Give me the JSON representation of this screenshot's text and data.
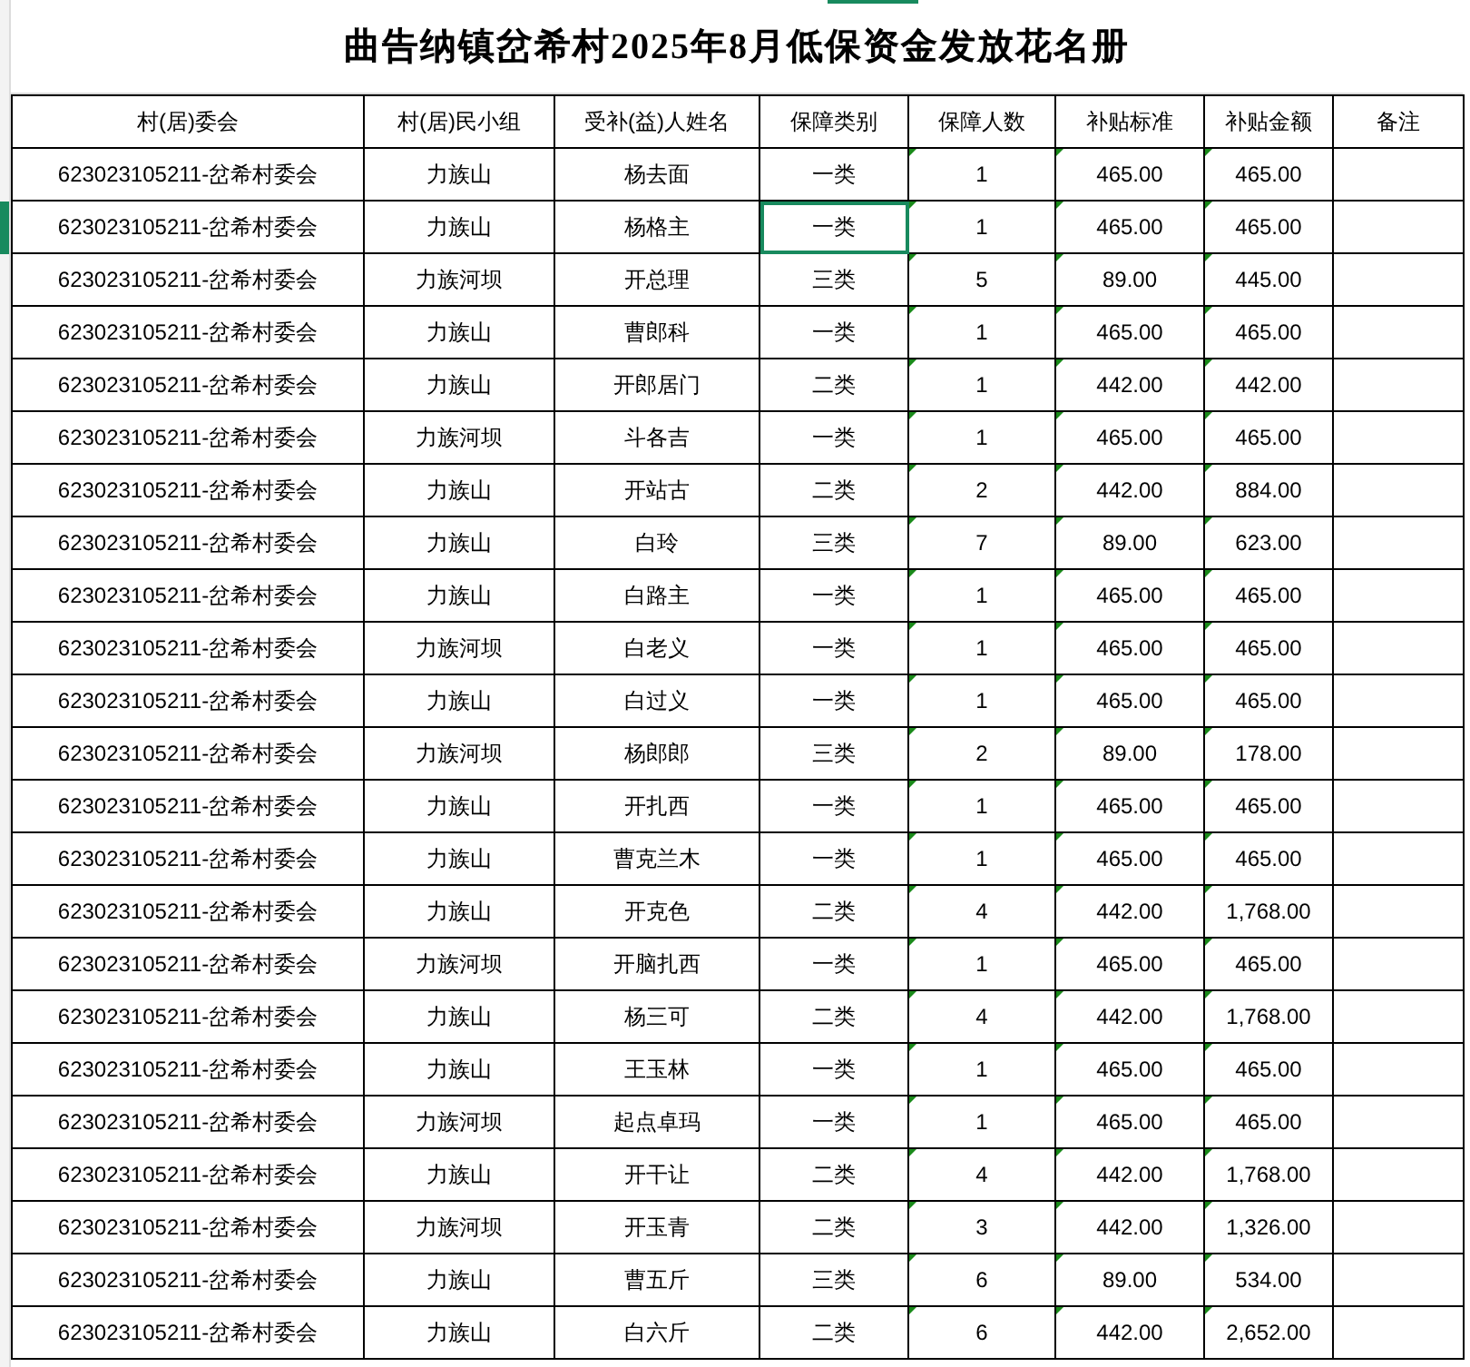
{
  "title": "曲告纳镇岔希村2025年8月低保资金发放花名册",
  "columns": [
    "村(居)委会",
    "村(居)民小组",
    "受补(益)人姓名",
    "保障类别",
    "保障人数",
    "补贴标准",
    "补贴金额",
    "备注"
  ],
  "rows": [
    {
      "cells": [
        "623023105211-岔希村委会",
        "力族山",
        "杨去面",
        "一类",
        "1",
        "465.00",
        "465.00"
      ],
      "selected": false
    },
    {
      "cells": [
        "623023105211-岔希村委会",
        "力族山",
        "杨格主",
        "一类",
        "1",
        "465.00",
        "465.00"
      ],
      "selected": true
    },
    {
      "cells": [
        "623023105211-岔希村委会",
        "力族河坝",
        "开总理",
        "三类",
        "5",
        "89.00",
        "445.00"
      ],
      "selected": false
    },
    {
      "cells": [
        "623023105211-岔希村委会",
        "力族山",
        "曹郎科",
        "一类",
        "1",
        "465.00",
        "465.00"
      ],
      "selected": false
    },
    {
      "cells": [
        "623023105211-岔希村委会",
        "力族山",
        "开郎居门",
        "二类",
        "1",
        "442.00",
        "442.00"
      ],
      "selected": false
    },
    {
      "cells": [
        "623023105211-岔希村委会",
        "力族河坝",
        "斗各吉",
        "一类",
        "1",
        "465.00",
        "465.00"
      ],
      "selected": false
    },
    {
      "cells": [
        "623023105211-岔希村委会",
        "力族山",
        "开站古",
        "二类",
        "2",
        "442.00",
        "884.00"
      ],
      "selected": false
    },
    {
      "cells": [
        "623023105211-岔希村委会",
        "力族山",
        "白玲",
        "三类",
        "7",
        "89.00",
        "623.00"
      ],
      "selected": false
    },
    {
      "cells": [
        "623023105211-岔希村委会",
        "力族山",
        "白路主",
        "一类",
        "1",
        "465.00",
        "465.00"
      ],
      "selected": false
    },
    {
      "cells": [
        "623023105211-岔希村委会",
        "力族河坝",
        "白老义",
        "一类",
        "1",
        "465.00",
        "465.00"
      ],
      "selected": false
    },
    {
      "cells": [
        "623023105211-岔希村委会",
        "力族山",
        "白过义",
        "一类",
        "1",
        "465.00",
        "465.00"
      ],
      "selected": false
    },
    {
      "cells": [
        "623023105211-岔希村委会",
        "力族河坝",
        "杨郎郎",
        "三类",
        "2",
        "89.00",
        "178.00"
      ],
      "selected": false
    },
    {
      "cells": [
        "623023105211-岔希村委会",
        "力族山",
        "开扎西",
        "一类",
        "1",
        "465.00",
        "465.00"
      ],
      "selected": false
    },
    {
      "cells": [
        "623023105211-岔希村委会",
        "力族山",
        "曹克兰木",
        "一类",
        "1",
        "465.00",
        "465.00"
      ],
      "selected": false
    },
    {
      "cells": [
        "623023105211-岔希村委会",
        "力族山",
        "开克色",
        "二类",
        "4",
        "442.00",
        "1,768.00"
      ],
      "selected": false
    },
    {
      "cells": [
        "623023105211-岔希村委会",
        "力族河坝",
        "开脑扎西",
        "一类",
        "1",
        "465.00",
        "465.00"
      ],
      "selected": false
    },
    {
      "cells": [
        "623023105211-岔希村委会",
        "力族山",
        "杨三可",
        "二类",
        "4",
        "442.00",
        "1,768.00"
      ],
      "selected": false
    },
    {
      "cells": [
        "623023105211-岔希村委会",
        "力族山",
        "王玉林",
        "一类",
        "1",
        "465.00",
        "465.00"
      ],
      "selected": false
    },
    {
      "cells": [
        "623023105211-岔希村委会",
        "力族河坝",
        "起点卓玛",
        "一类",
        "1",
        "465.00",
        "465.00"
      ],
      "selected": false
    },
    {
      "cells": [
        "623023105211-岔希村委会",
        "力族山",
        "开干让",
        "二类",
        "4",
        "442.00",
        "1,768.00"
      ],
      "selected": false
    },
    {
      "cells": [
        "623023105211-岔希村委会",
        "力族河坝",
        "开玉青",
        "二类",
        "3",
        "442.00",
        "1,326.00"
      ],
      "selected": false
    },
    {
      "cells": [
        "623023105211-岔希村委会",
        "力族山",
        "曹五斤",
        "三类",
        "6",
        "89.00",
        "534.00"
      ],
      "selected": false
    },
    {
      "cells": [
        "623023105211-岔希村委会",
        "力族山",
        "白六斤",
        "二类",
        "6",
        "442.00",
        "2,652.00"
      ],
      "selected": false
    }
  ]
}
